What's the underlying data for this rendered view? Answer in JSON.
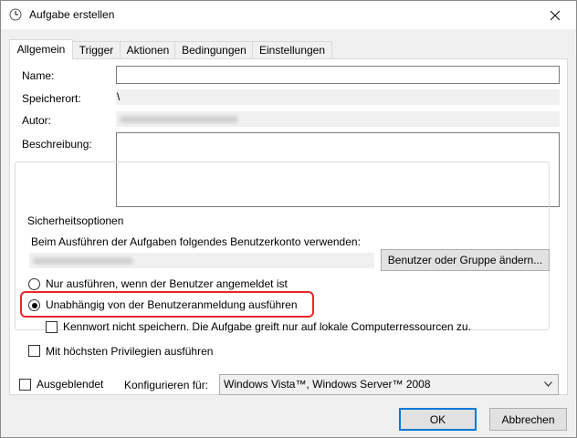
{
  "window": {
    "title": "Aufgabe erstellen",
    "title_icon": "clock-icon",
    "close_icon": "close-icon"
  },
  "tabs": [
    {
      "label": "Allgemein",
      "active": true
    },
    {
      "label": "Trigger"
    },
    {
      "label": "Aktionen"
    },
    {
      "label": "Bedingungen"
    },
    {
      "label": "Einstellungen"
    }
  ],
  "general": {
    "name_label": "Name:",
    "name_value": "",
    "location_label": "Speicherort:",
    "location_value": "\\",
    "author_label": "Autor:",
    "description_label": "Beschreibung:",
    "description_value": ""
  },
  "security": {
    "legend": "Sicherheitsoptionen",
    "account_prompt": "Beim Ausführen der Aufgaben folgendes Benutzerkonto verwenden:",
    "change_button": "Benutzer oder Gruppe ändern...",
    "radio_logged_on": "Nur ausführen, wenn der Benutzer angemeldet ist",
    "radio_independent": "Unabhängig von der Benutzeranmeldung ausführen",
    "selected_radio": "independent",
    "no_password_check": "Kennwort nicht speichern. Die Aufgabe greift nur auf lokale Computerressourcen zu.",
    "highest_priv_check": "Mit höchsten Privilegien ausführen",
    "highlight_color": "#e8262a"
  },
  "bottom": {
    "hidden_check": "Ausgeblendet",
    "configure_label": "Konfigurieren für:",
    "configure_value": "Windows Vista™, Windows Server™ 2008"
  },
  "buttons": {
    "ok": "OK",
    "cancel": "Abbrechen"
  },
  "colors": {
    "focus_blue": "#0078d7"
  }
}
